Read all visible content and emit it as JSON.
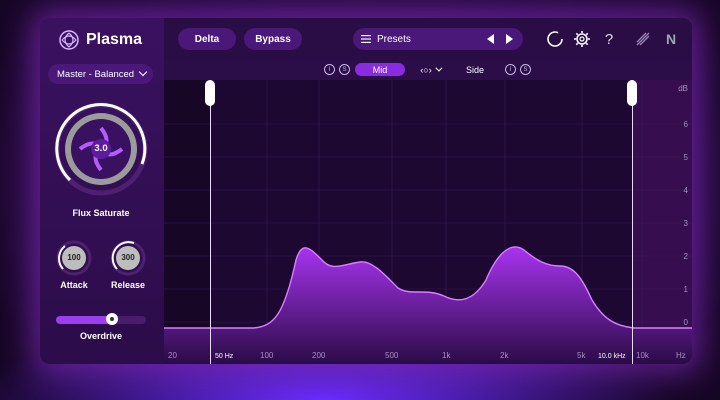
{
  "app": {
    "name": "Plasma"
  },
  "toolbar": {
    "delta_label": "Delta",
    "bypass_label": "Bypass",
    "presets_label": "Presets",
    "help_glyph": "?",
    "brand_mark": "N"
  },
  "left": {
    "preset_select": "Master - Balanced",
    "flux": {
      "value": "3.0",
      "label": "Flux Saturate"
    },
    "attack": {
      "value": "100",
      "label": "Attack"
    },
    "release": {
      "value": "300",
      "label": "Release"
    },
    "overdrive": {
      "label": "Overdrive",
      "level": 0.62
    }
  },
  "modes": {
    "chip_i": "I",
    "chip_s": "S",
    "mid": "Mid",
    "side": "Side",
    "link_glyph": "‹○›"
  },
  "display": {
    "db_unit": "dB",
    "db_ticks": [
      "6",
      "5",
      "4",
      "3",
      "2",
      "1",
      "0"
    ],
    "freq_ticks": [
      "20",
      "50 Hz",
      "100",
      "200",
      "500",
      "1k",
      "2k",
      "5k",
      "10.0 kHz",
      "10k",
      "Hz"
    ]
  },
  "colors": {
    "accent": "#8a2be2",
    "panel": "#2b0e47"
  }
}
